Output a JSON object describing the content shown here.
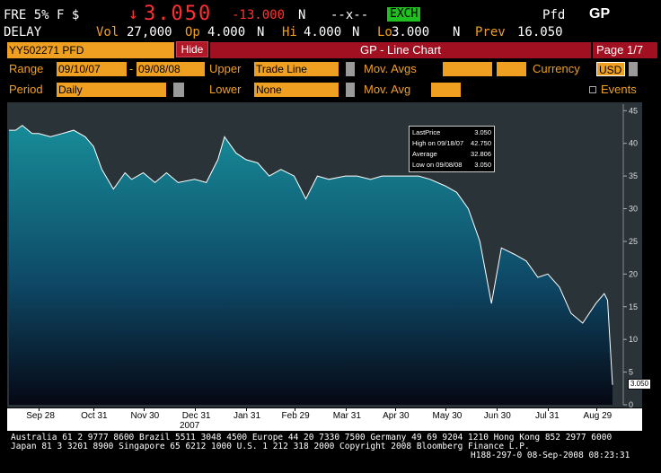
{
  "header": {
    "ticker": "FRE 5% F $",
    "arrow": "↓",
    "price": "3.050",
    "change": "-13.000",
    "n1": "N",
    "ask": "--x--",
    "exch": "EXCH",
    "pfd": "Pfd",
    "gp": "GP",
    "delay": "DELAY",
    "vol_label": "Vol",
    "vol": "27,000",
    "op_label": "Op",
    "op": "4.000",
    "n2": "N",
    "hi_label": "Hi",
    "hi": "4.000",
    "n3": "N",
    "lo_label": "Lo",
    "lo": "3.000",
    "n4": "N",
    "prev_label": "Prev",
    "prev": "16.050"
  },
  "titlebar": {
    "security": "YY502271 PFD",
    "hide": "Hide",
    "title": "GP - Line Chart",
    "page": "Page 1/7"
  },
  "controls": {
    "range_label": "Range",
    "range_start": "09/10/07",
    "range_dash": "-",
    "range_end": "09/08/08",
    "upper_label": "Upper",
    "upper_value": "Trade Line",
    "movavgs_label": "Mov. Avgs",
    "currency_label": "Currency",
    "currency_value": "USD",
    "period_label": "Period",
    "period_value": "Daily",
    "lower_label": "Lower",
    "lower_value": "None",
    "movavg_label": "Mov. Avg",
    "events_label": "Events"
  },
  "legend": {
    "rows": [
      {
        "label": "LastPrice",
        "value": "3.050"
      },
      {
        "label": "High on 09/18/07",
        "value": "42.750"
      },
      {
        "label": "Average",
        "value": "32.806"
      },
      {
        "label": "Low on 09/08/08",
        "value": "3.050"
      }
    ]
  },
  "last_price_tag": "3.050",
  "chart_data": {
    "type": "area",
    "ylim": [
      0,
      46
    ],
    "yticks": [
      "45",
      "40",
      "35",
      "30",
      "25",
      "20",
      "15",
      "10",
      "5",
      "0"
    ],
    "xticks": [
      "Sep 28",
      "Oct 31",
      "Nov 30",
      "Dec 31",
      "Jan 31",
      "Feb 29",
      "Mar 31",
      "Apr 30",
      "May 30",
      "Jun 30",
      "Jul 31",
      "Aug 29"
    ],
    "year_label": "2007",
    "x": [
      "2007-09-10",
      "2007-09-14",
      "2007-09-18",
      "2007-09-24",
      "2007-09-28",
      "2007-10-05",
      "2007-10-12",
      "2007-10-19",
      "2007-10-26",
      "2007-10-31",
      "2007-11-05",
      "2007-11-12",
      "2007-11-19",
      "2007-11-23",
      "2007-11-30",
      "2007-12-07",
      "2007-12-14",
      "2007-12-21",
      "2007-12-31",
      "2008-01-07",
      "2008-01-14",
      "2008-01-18",
      "2008-01-25",
      "2008-01-31",
      "2008-02-07",
      "2008-02-14",
      "2008-02-21",
      "2008-02-29",
      "2008-03-07",
      "2008-03-14",
      "2008-03-21",
      "2008-03-31",
      "2008-04-07",
      "2008-04-15",
      "2008-04-22",
      "2008-04-30",
      "2008-05-07",
      "2008-05-14",
      "2008-05-21",
      "2008-05-30",
      "2008-06-06",
      "2008-06-13",
      "2008-06-20",
      "2008-06-27",
      "2008-07-03",
      "2008-07-11",
      "2008-07-18",
      "2008-07-25",
      "2008-07-31",
      "2008-08-07",
      "2008-08-14",
      "2008-08-21",
      "2008-08-29",
      "2008-09-03",
      "2008-09-05",
      "2008-09-08"
    ],
    "values": [
      42.0,
      42.0,
      42.75,
      41.5,
      41.5,
      41.0,
      41.5,
      42.0,
      41.0,
      39.5,
      36.0,
      33.0,
      35.5,
      34.5,
      35.5,
      34.0,
      35.5,
      34.0,
      34.5,
      34.0,
      37.5,
      41.0,
      38.5,
      37.5,
      37.0,
      35.0,
      36.0,
      35.0,
      31.5,
      35.0,
      34.5,
      35.0,
      35.0,
      34.5,
      35.0,
      35.0,
      35.0,
      35.0,
      34.5,
      33.5,
      32.5,
      30.0,
      25.0,
      15.5,
      24.0,
      23.0,
      22.0,
      19.5,
      20.0,
      18.0,
      14.0,
      12.5,
      15.5,
      17.0,
      16.0,
      3.05
    ],
    "series": [
      {
        "values_ref": "values",
        "color": "#1a8aa0"
      }
    ],
    "colors": {
      "fill_top": "#178c98",
      "fill_bottom": "#060814",
      "line": "#ffffff",
      "plot_bg": "#2a3438"
    }
  },
  "footer": {
    "line1": "Australia 61 2 9777 8600 Brazil 5511 3048 4500 Europe 44 20 7330 7500 Germany 49 69 9204 1210 Hong Kong 852 2977 6000",
    "line2": "Japan 81 3 3201 8900        Singapore 65 6212 1000        U.S. 1 212 318 2000        Copyright 2008 Bloomberg Finance L.P.",
    "line3": "H188-297-0 08-Sep-2008 08:23:31"
  }
}
